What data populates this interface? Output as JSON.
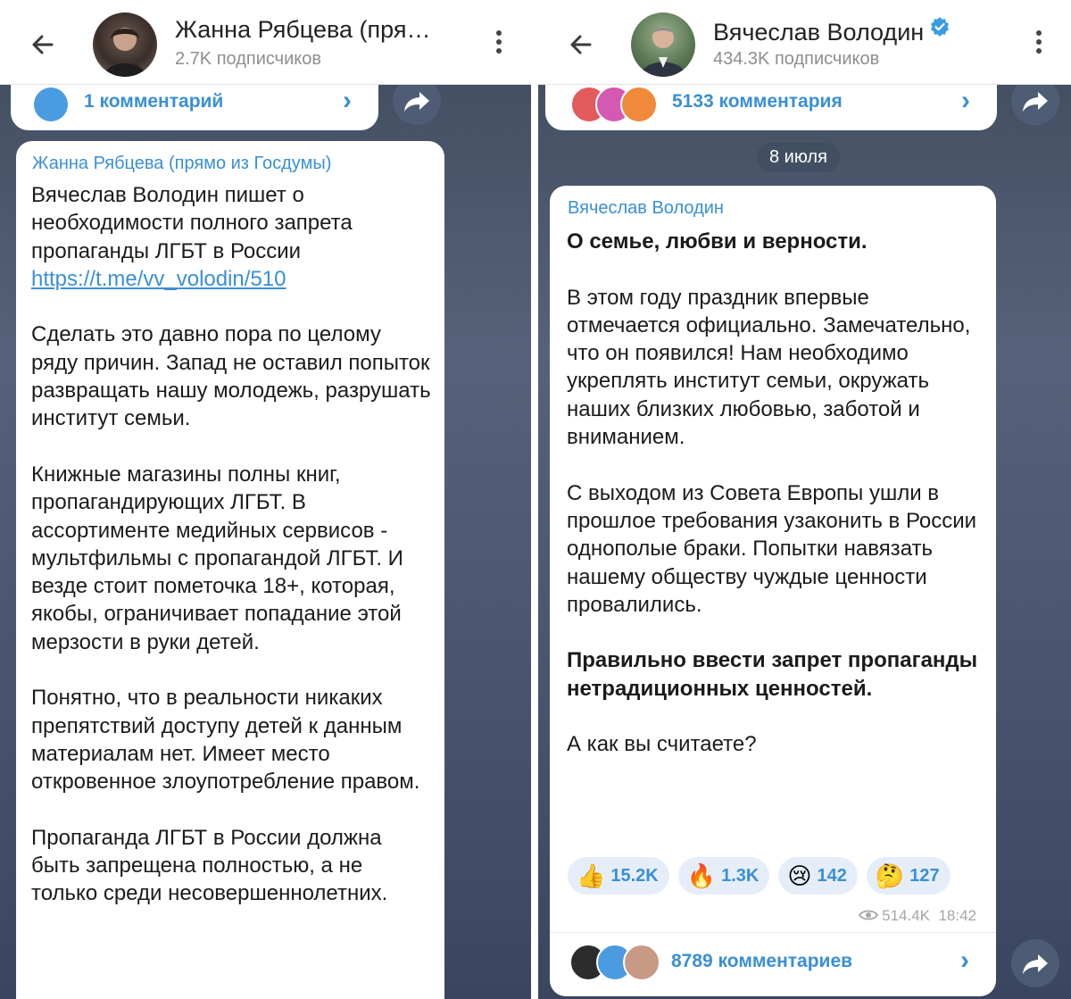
{
  "left": {
    "header": {
      "title": "Жанна Рябцева (пря…",
      "subtitle": "2.7K подписчиков"
    },
    "comments_bar": {
      "label": "1 комментарий"
    },
    "post": {
      "author": "Жанна Рябцева (прямо из Госдумы)",
      "paragraphs": [
        "Вячеслав Володин пишет о необходимости полного запрета пропаганды ЛГБТ в России",
        "Сделать это давно пора по целому ряду причин. Запад не оставил попыток развращать нашу молодежь, разрушать институт семьи.",
        "Книжные магазины полны книг, пропагандирующих ЛГБТ. В ассортименте медийных сервисов - мультфильмы с пропагандой ЛГБТ. И везде стоит пометочка 18+, которая, якобы, ограничивает попадание этой мерзости в руки детей.",
        "Понятно, что в реальности никаких препятствий доступу детей к данным материалам нет. Имеет место откровенное злоупотребление правом.",
        "Пропаганда ЛГБТ в России должна быть запрещена полностью, а не только среди несовершеннолетних."
      ],
      "link": "https://t.me/vv_volodin/510"
    }
  },
  "right": {
    "header": {
      "title": "Вячеслав Володин",
      "subtitle": "434.3K подписчиков"
    },
    "top_comments_bar": {
      "label": "5133 комментария"
    },
    "date_pill": "8 июля",
    "post": {
      "author": "Вячеслав Володин",
      "heading": "О семье, любви и верности.",
      "paragraphs": [
        "В этом году праздник впервые отмечается официально. Замечательно, что он появился! Нам необходимо укреплять институт семьи, окружать наших близких любовью, заботой и вниманием.",
        "С выходом из Совета Европы ушли в прошлое требования узаконить в России однополые браки. Попытки навязать нашему обществу чуждые ценности провалились."
      ],
      "bold_paragraph": "Правильно ввести запрет пропаганды нетрадиционных ценностей.",
      "question": "А как вы считаете?",
      "reactions": [
        {
          "icon": "thumbs-up-icon",
          "emoji": "👍",
          "count": "15.2K"
        },
        {
          "icon": "fire-icon",
          "emoji": "🔥",
          "count": "1.3K"
        },
        {
          "icon": "crying-face-icon",
          "emoji": "😢",
          "count": "142"
        },
        {
          "icon": "thinking-face-icon",
          "emoji": "🤔",
          "count": "127"
        }
      ],
      "views": "514.4K",
      "time": "18:42"
    },
    "bottom_comments_bar": {
      "label": "8789 комментариев"
    }
  },
  "colors": {
    "accent": "#3a8fd6",
    "verified": "#3a9be0"
  }
}
